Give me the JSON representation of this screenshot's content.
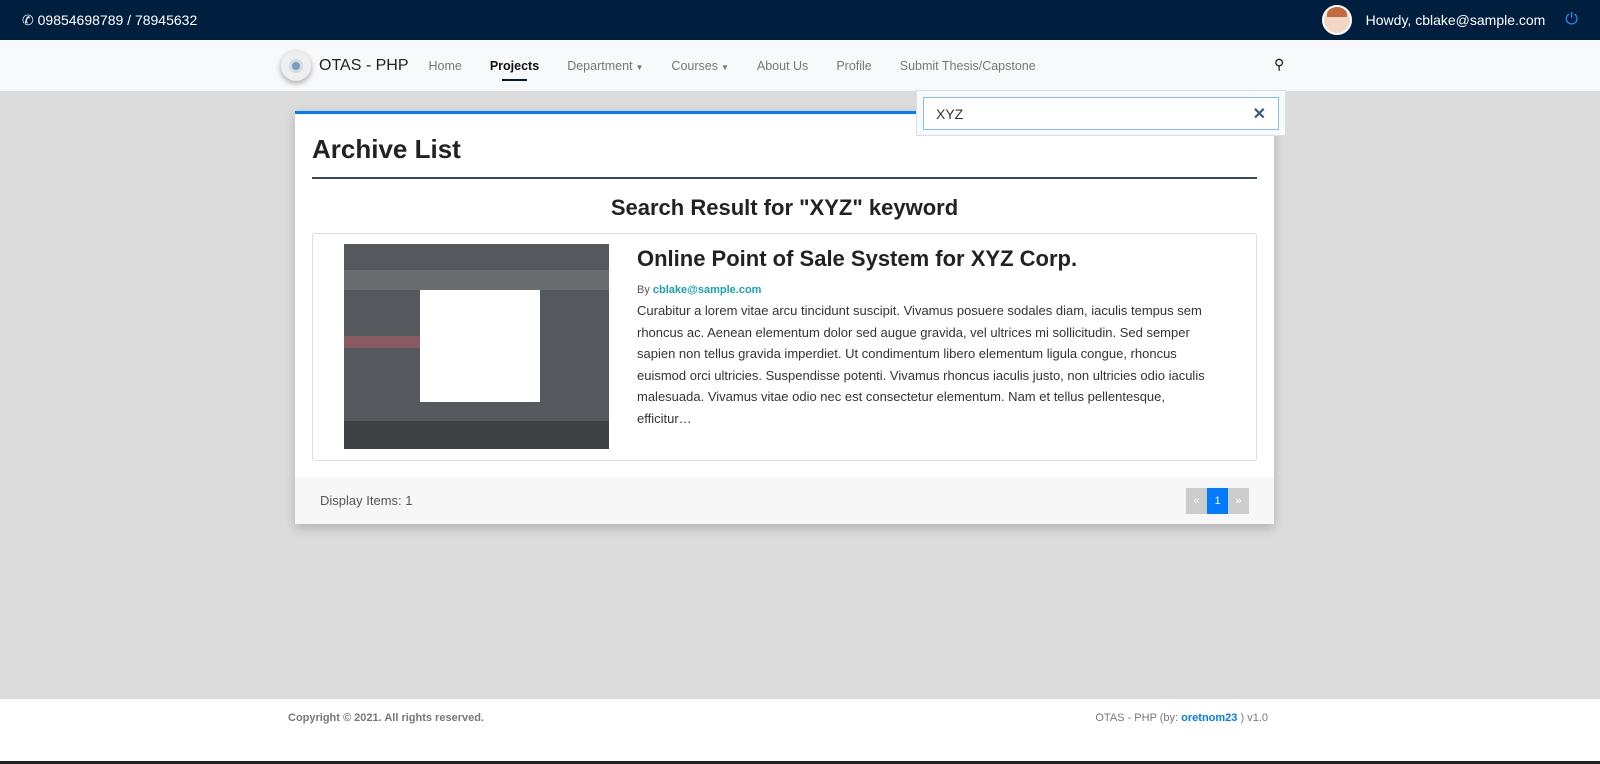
{
  "topbar": {
    "phone": "09854698789 / 78945632",
    "greeting": "Howdy, cblake@sample.com"
  },
  "nav": {
    "brand": "OTAS - PHP",
    "items": [
      {
        "label": "Home"
      },
      {
        "label": "Projects",
        "active": true
      },
      {
        "label": "Department"
      },
      {
        "label": "Courses"
      },
      {
        "label": "About Us"
      },
      {
        "label": "Profile"
      },
      {
        "label": "Submit Thesis/Capstone"
      }
    ]
  },
  "search": {
    "value": "XYZ"
  },
  "main": {
    "title": "Archive List",
    "result_heading": "Search Result for \"XYZ\" keyword",
    "results": [
      {
        "title": "Online Point of Sale System for XYZ Corp.",
        "by_label": "By",
        "author": "cblake@sample.com",
        "description": "Curabitur a lorem vitae arcu tincidunt suscipit. Vivamus posuere sodales diam, iaculis tempus sem rhoncus ac. Aenean elementum dolor sed augue gravida, vel ultrices mi sollicitudin. Sed semper sapien non tellus gravida imperdiet. Ut condimentum libero elementum ligula congue, rhoncus euismod orci ultricies. Suspendisse potenti. Vivamus rhoncus iaculis justo, non ultricies odio iaculis malesuada. Vivamus vitae odio nec est consectetur elementum. Nam et tellus pellentesque, efficitur…"
      }
    ],
    "display_items": "Display Items: 1",
    "pagination": {
      "prev": "«",
      "current": "1",
      "next": "»"
    }
  },
  "footer": {
    "copyright": "Copyright © 2021. All rights reserved.",
    "credit_prefix": "OTAS - PHP (by:",
    "credit_author": "oretnom23",
    "credit_suffix": ") v1.0"
  }
}
